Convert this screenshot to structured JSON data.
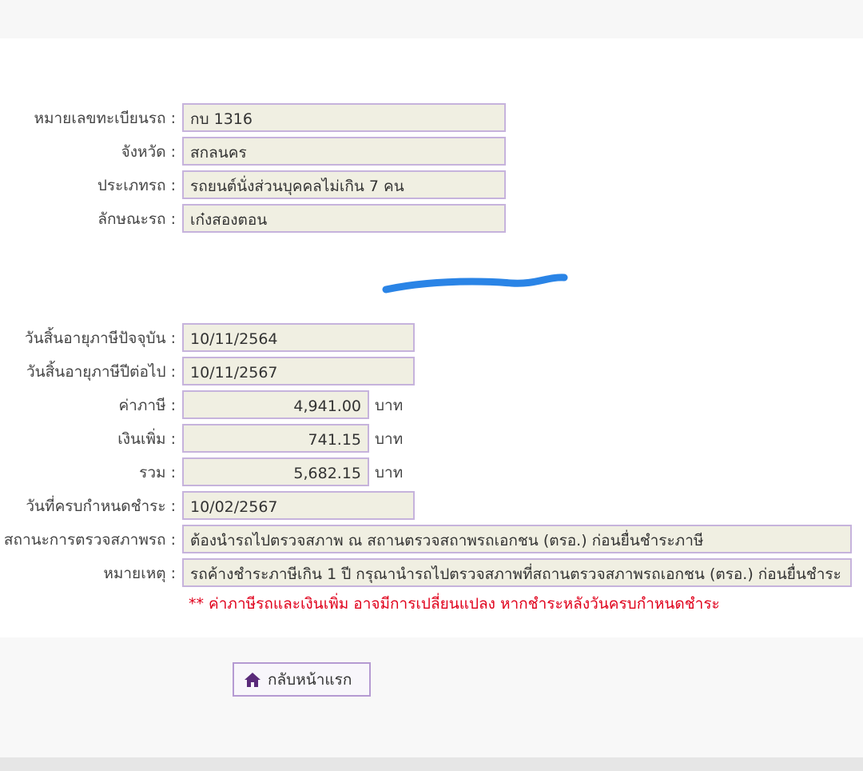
{
  "vehicle": {
    "plate": {
      "label": "หมายเลขทะเบียนรถ :",
      "value": "กบ 1316"
    },
    "province": {
      "label": "จังหวัด :",
      "value": "สกลนคร"
    },
    "type": {
      "label": "ประเภทรถ :",
      "value": "รถยนต์นั่งส่วนบุคคลไม่เกิน 7 คน"
    },
    "body": {
      "label": "ลักษณะรถ :",
      "value": "เก๋งสองตอน"
    }
  },
  "tax": {
    "current_expiry": {
      "label": "วันสิ้นอายุภาษีปัจจุบัน :",
      "value": "10/11/2564"
    },
    "next_expiry": {
      "label": "วันสิ้นอายุภาษีปีต่อไป :",
      "value": "10/11/2567"
    },
    "tax_amount": {
      "label": "ค่าภาษี :",
      "value": "4,941.00",
      "unit": "บาท"
    },
    "surcharge": {
      "label": "เงินเพิ่ม :",
      "value": "741.15",
      "unit": "บาท"
    },
    "total": {
      "label": "รวม :",
      "value": "5,682.15",
      "unit": "บาท"
    },
    "due_date": {
      "label": "วันที่ครบกำหนดชำระ :",
      "value": "10/02/2567"
    },
    "inspection_status": {
      "label": "สถานะการตรวจสภาพรถ :",
      "value": "ต้องนำรถไปตรวจสภาพ ณ สถานตรวจสถาพรถเอกชน (ตรอ.) ก่อนยื่นชำระภาษี"
    },
    "remark": {
      "label": "หมายเหตุ :",
      "value": "รถค้างชำระภาษีเกิน 1 ปี กรุณานำรถไปตรวจสภาพที่สถานตรวจสภาพรถเอกชน (ตรอ.) ก่อนยื่นชำระ"
    },
    "warning": "** ค่าภาษีรถและเงินเพิ่ม อาจมีการเปลี่ยนแปลง หากชำระหลังวันครบกำหนดชำระ"
  },
  "actions": {
    "home_label": "กลับหน้าแรก",
    "home_icon": "home-icon"
  },
  "colors": {
    "field_border": "#c6b3dc",
    "field_bg": "#f0efe2",
    "warning": "#e0001b",
    "scribble": "#2a84e6",
    "home_icon": "#5a2a7a"
  }
}
